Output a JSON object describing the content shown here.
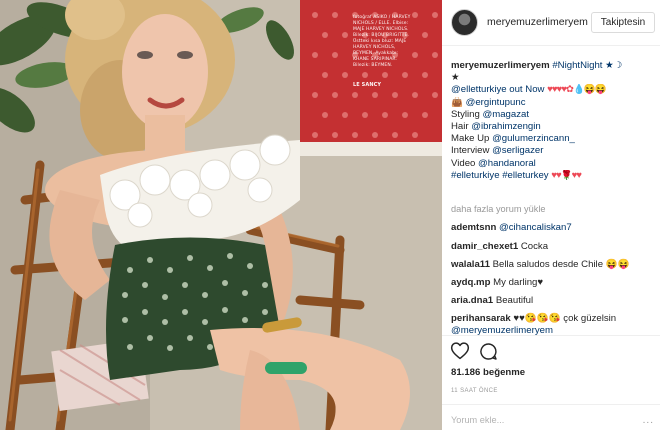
{
  "post": {
    "magazine_credits": "fotoğraf ASIKO / HARVEY NICHOLS / ELLE. Elbise: MAJE HARVEY NICHOLS. Bilezik: BIJOU BRIGITTE. Üstteki kısa bluz: MAJE HARVEY NICHOLS, BEYMEN. Ayakkabı: KHANE SARIPINAR. Bilezik: BEYMEN.",
    "mag_corner": "LE SANCY"
  },
  "header": {
    "username": "meryemuzerlimeryem",
    "follow_label": "Takiptesin"
  },
  "caption": {
    "author": "meryemuzerlimeryem",
    "lines": [
      {
        "text": "#NightNight ★☽",
        "mention": true
      },
      {
        "text": "★",
        "mention": false
      },
      {
        "text": "@elletturkiye out Now",
        "mention": true,
        "suffix": "♥♥♥♥✿💧😝😝"
      },
      {
        "text": "👜 @ergintuрunc",
        "mention": true
      },
      {
        "text": "Styling @magazat",
        "prefix": "Styling ",
        "handle": "@magazat"
      },
      {
        "text": "Hair @ibrahimzengin",
        "prefix": "Hair ",
        "handle": "@ibrahimzengin"
      },
      {
        "text": "Make Up @gulumerzincann_",
        "prefix": "Make Up ",
        "handle": "@gulumerzincann_"
      },
      {
        "text": "Interview @serligazer",
        "prefix": "Interview ",
        "handle": "@serligazer"
      },
      {
        "text": "Video @handanoral",
        "prefix": "Video ",
        "handle": "@handanoral"
      },
      {
        "text": "#elleturkiye #elleturkey",
        "mention": true,
        "suffix": "♥♥🌹♥♥"
      }
    ]
  },
  "load_more": "daha fazla yorum yükle",
  "comments": [
    {
      "user": "ademtsnn",
      "text": "@cihancaliskan7",
      "mention": true
    },
    {
      "user": "damir_chexet1",
      "text": "Сосkа",
      "mention": false
    },
    {
      "user": "walala11",
      "text": "Bella saludos desde Chile 😝😝",
      "mention": false
    },
    {
      "user": "aydq.mp",
      "text": "My darling♥",
      "mention": false
    },
    {
      "user": "aria.dna1",
      "text": "Beautiful",
      "mention": false
    },
    {
      "user": "perihansarak",
      "text": "♥♥😘😘😘 çok güzelsin",
      "mention": false
    },
    {
      "user": "",
      "text": "@meryemuzerlimeryem",
      "mention": true
    }
  ],
  "likes": "81.186 beğenme",
  "timestamp": "11 SAAT ÖNCE",
  "add_comment_placeholder": "Yorum ekle...",
  "more_options": "...",
  "icons": {
    "like": "heart-icon",
    "comment": "comment-icon"
  },
  "colors": {
    "mention": "#003569",
    "muted": "#999999",
    "text": "#262626"
  }
}
